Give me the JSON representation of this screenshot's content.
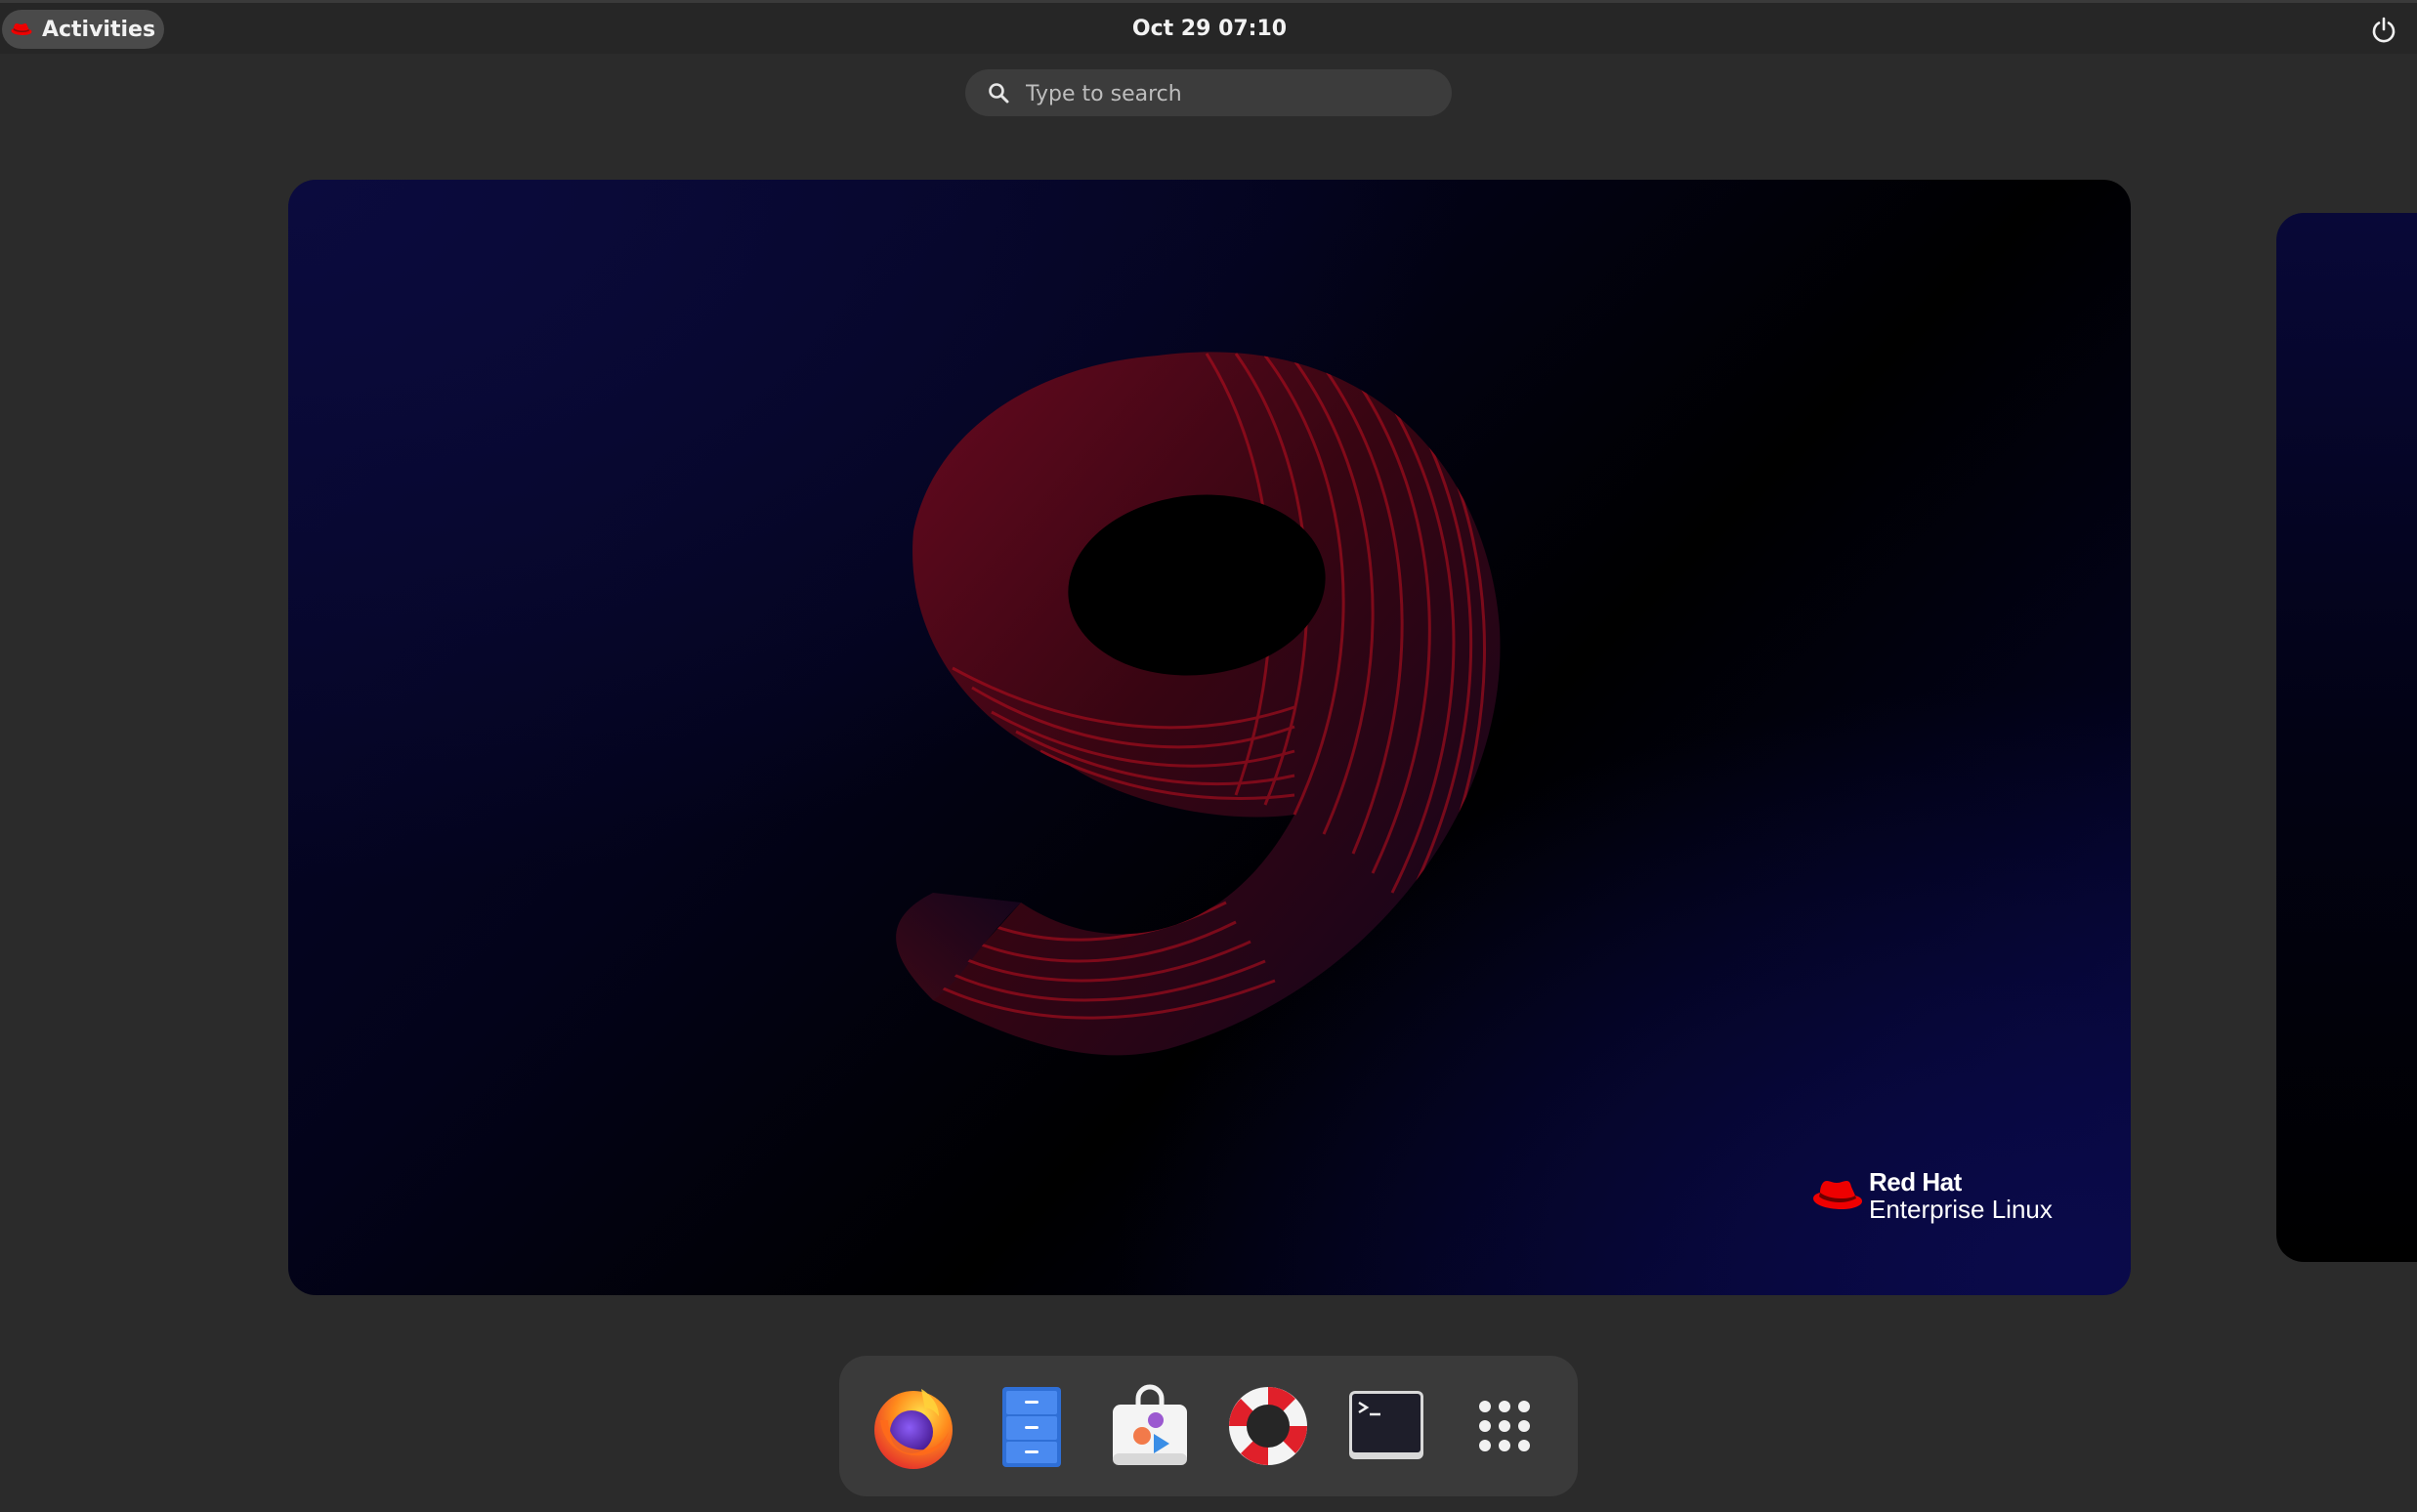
{
  "topbar": {
    "activities_label": "Activities",
    "clock": "Oct 29  07:10",
    "power_icon": "power-icon"
  },
  "search": {
    "placeholder": "Type to search",
    "icon": "search-icon"
  },
  "wallpaper": {
    "numeral": "9",
    "brand_line1": "Red Hat",
    "brand_line2": "Enterprise Linux",
    "accent_color": "#ee0000"
  },
  "dock": {
    "items": [
      {
        "name": "firefox",
        "icon": "firefox-icon"
      },
      {
        "name": "files",
        "icon": "files-icon"
      },
      {
        "name": "software",
        "icon": "software-icon"
      },
      {
        "name": "help",
        "icon": "help-icon"
      },
      {
        "name": "terminal",
        "icon": "terminal-icon"
      },
      {
        "name": "show-apps",
        "icon": "app-grid-icon"
      }
    ]
  }
}
